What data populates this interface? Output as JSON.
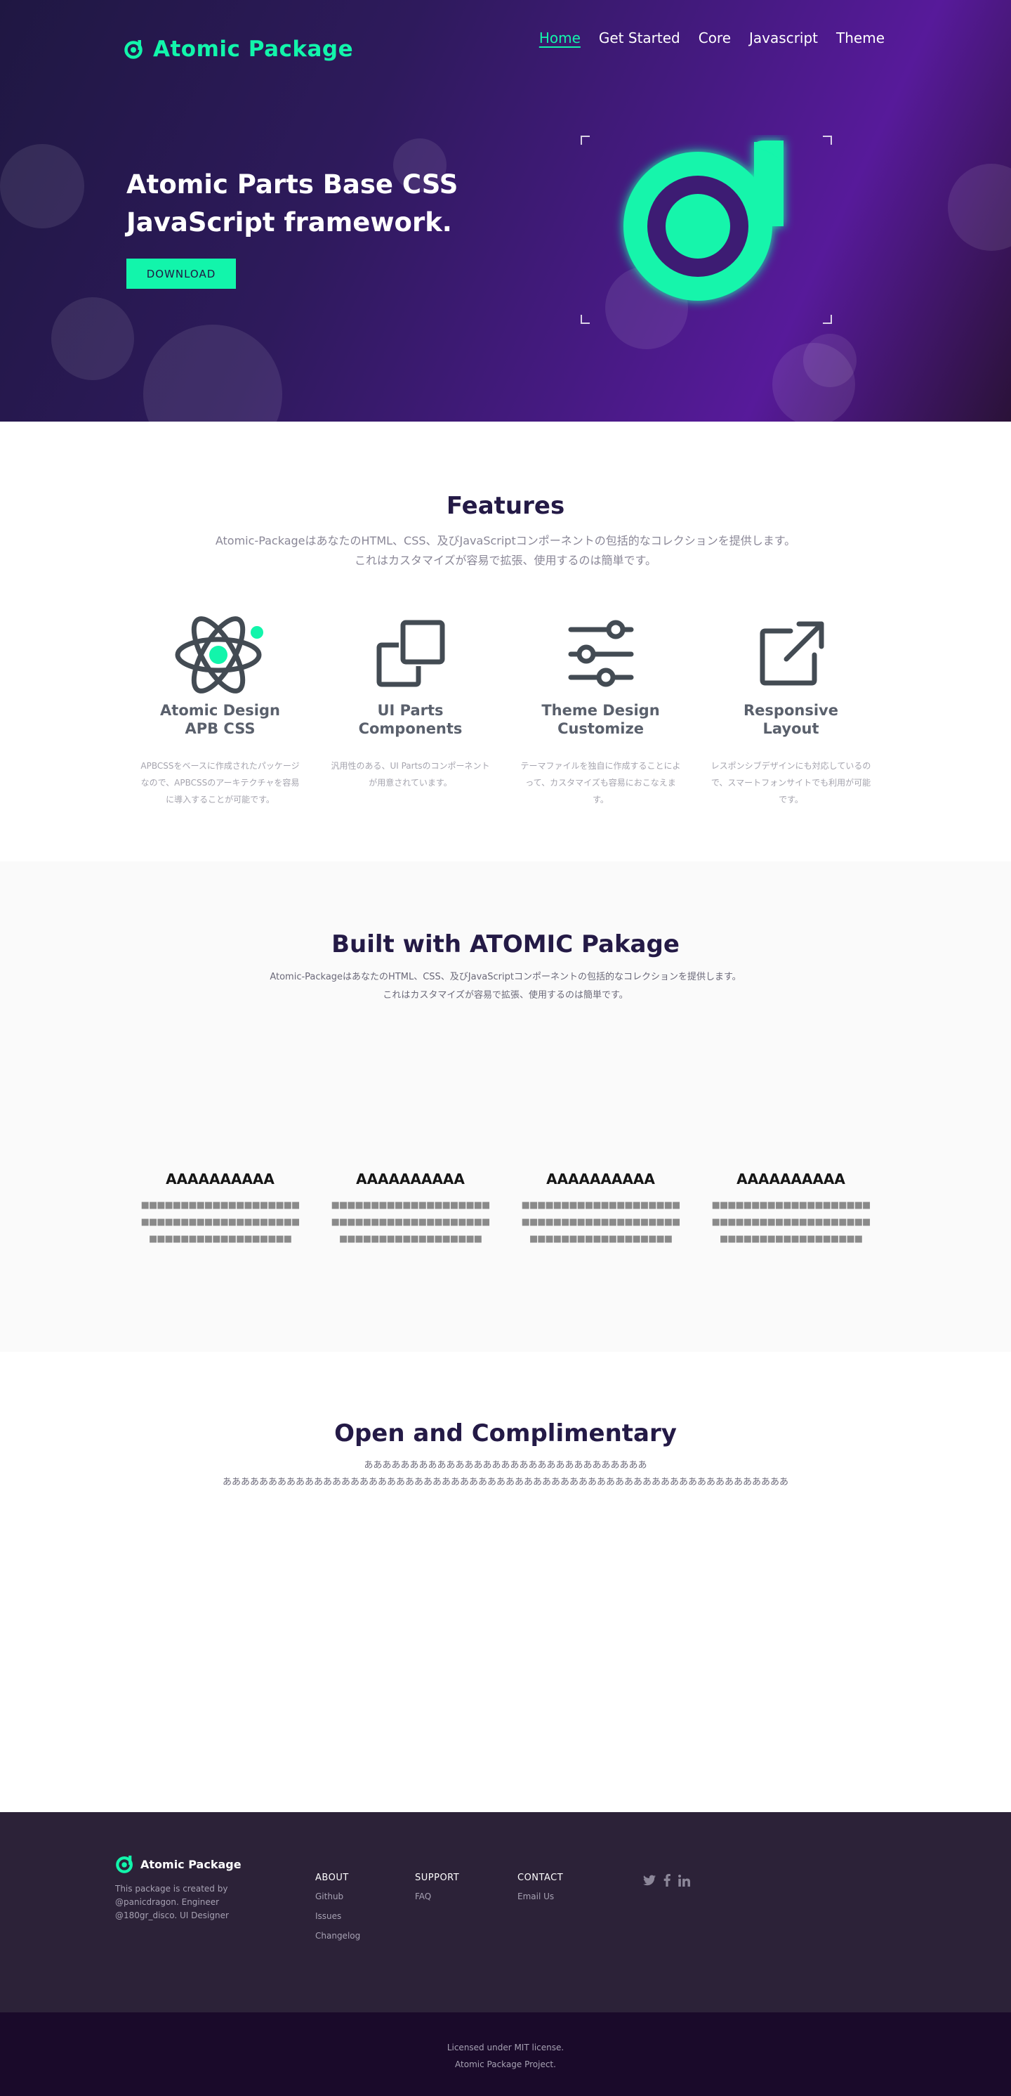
{
  "brand": {
    "name": "Atomic Package",
    "accent": "#12f5ab",
    "dark": "#241a46"
  },
  "nav": {
    "items": [
      {
        "label": "Home",
        "active": true
      },
      {
        "label": "Get Started"
      },
      {
        "label": "Core"
      },
      {
        "label": "Javascript"
      },
      {
        "label": "Theme"
      }
    ]
  },
  "hero": {
    "title_line1": "Atomic Parts Base CSS",
    "title_line2": "JavaScript framework.",
    "download_label": "DOWNLOAD"
  },
  "features": {
    "title": "Features",
    "desc_line1": "Atomic-PackageはあなたのHTML、CSS、及びJavaScriptコンポーネントの包括的なコレクションを提供します。",
    "desc_line2": "これはカスタマイズが容易で拡張、使用するのは簡単です。",
    "items": [
      {
        "icon": "atom-icon",
        "title_line1": "Atomic Design",
        "title_line2": "APB CSS",
        "text": "APBCSSをベースに作成されたパッケージなので、APBCSSのアーキテクチャを容易に導入することが可能です。"
      },
      {
        "icon": "copy-icon",
        "title_line1": "UI Parts",
        "title_line2": "Components",
        "text": "汎用性のある、UI Partsのコンポーネントが用意されています。"
      },
      {
        "icon": "sliders-icon",
        "title_line1": "Theme Design",
        "title_line2": "Customize",
        "text": "テーマファイルを独自に作成することによって、カスタマイズも容易におこなえます。"
      },
      {
        "icon": "external-link-icon",
        "title_line1": "Responsive",
        "title_line2": "Layout",
        "text": "レスポンシブデザインにも対応しているので、スマートフォンサイトでも利用が可能です。"
      }
    ]
  },
  "built": {
    "title": "Built with ATOMIC Pakage",
    "desc_line1": "Atomic-PackageはあなたのHTML、CSS、及びJavaScriptコンポーネントの包括的なコレクションを提供します。",
    "desc_line2": "これはカスタマイズが容易で拡張、使用するのは簡単です。",
    "cards": [
      {
        "title": "AAAAAAAAAA",
        "text": "■■■■■■■■■■■■■■■■■■■■■■■■■■■■■■■■■■■■■■■■■■■■■■■■■■■■■■■■■■"
      },
      {
        "title": "AAAAAAAAAA",
        "text": "■■■■■■■■■■■■■■■■■■■■■■■■■■■■■■■■■■■■■■■■■■■■■■■■■■■■■■■■■■"
      },
      {
        "title": "AAAAAAAAAA",
        "text": "■■■■■■■■■■■■■■■■■■■■■■■■■■■■■■■■■■■■■■■■■■■■■■■■■■■■■■■■■■"
      },
      {
        "title": "AAAAAAAAAA",
        "text": "■■■■■■■■■■■■■■■■■■■■■■■■■■■■■■■■■■■■■■■■■■■■■■■■■■■■■■■■■■"
      }
    ]
  },
  "open": {
    "title": "Open and Complimentary",
    "desc_line1": "あああああああああああああああああああああああああああああああ",
    "desc_line2": "ああああああああああああああああああああああああああああああああああああああああああああああああああああああああああああああ"
  },
  "footer": {
    "brand_name": "Atomic Package",
    "desc": "This package is created by @panicdragon. Engineer @180gr_disco. UI Designer",
    "columns": [
      {
        "title": "ABOUT",
        "links": [
          "Github",
          "Issues",
          "Changelog"
        ]
      },
      {
        "title": "SUPPORT",
        "links": [
          "FAQ"
        ]
      },
      {
        "title": "CONTACT",
        "links": [
          "Email Us"
        ]
      }
    ],
    "social": [
      "twitter-icon",
      "facebook-icon",
      "linkedin-icon"
    ],
    "license_line1": "Licensed under MIT license.",
    "license_line2": "Atomic Package Project."
  }
}
